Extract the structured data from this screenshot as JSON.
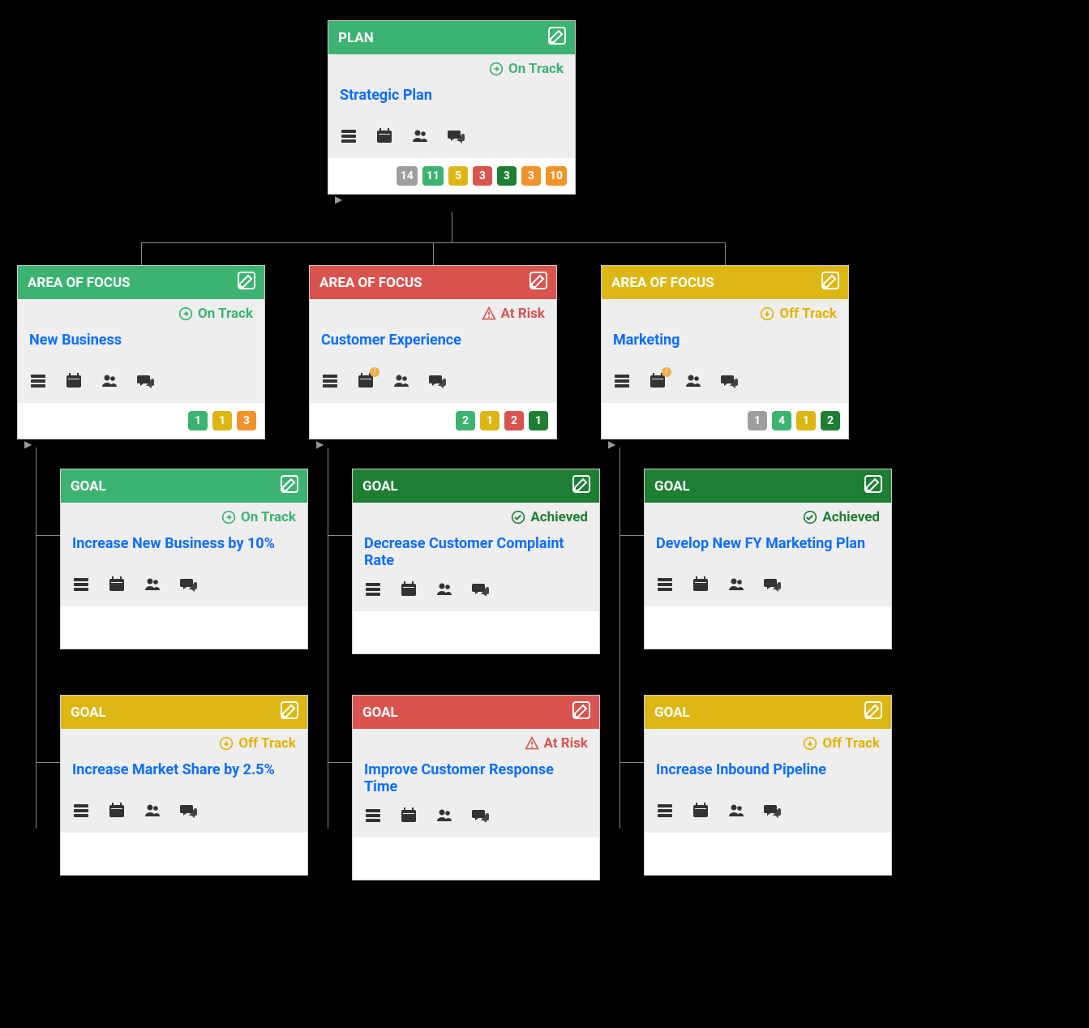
{
  "status_labels": {
    "on_track": "On Track",
    "off_track": "Off Track",
    "at_risk": "At Risk",
    "achieved": "Achieved"
  },
  "card_types": {
    "plan": "PLAN",
    "area": "AREA OF FOCUS",
    "goal": "GOAL"
  },
  "colors": {
    "green": "#3cb371",
    "dark_green": "#1e7e34",
    "yellow": "#dcb714",
    "red": "#d9534f",
    "orange": "#f0932b",
    "gray": "#9e9e9e"
  },
  "plan": {
    "title": "Strategic Plan",
    "status": "on_track",
    "header_color": "green",
    "badges": [
      {
        "n": 14,
        "c": "gray"
      },
      {
        "n": 11,
        "c": "green"
      },
      {
        "n": 5,
        "c": "yellow"
      },
      {
        "n": 3,
        "c": "red"
      },
      {
        "n": 3,
        "c": "dgreen"
      },
      {
        "n": 3,
        "c": "orange"
      },
      {
        "n": 10,
        "c": "orange"
      }
    ]
  },
  "areas": [
    {
      "title": "New Business",
      "status": "on_track",
      "header_color": "green",
      "calendar_alert": false,
      "badges": [
        {
          "n": 1,
          "c": "green"
        },
        {
          "n": 1,
          "c": "yellow"
        },
        {
          "n": 3,
          "c": "orange"
        }
      ],
      "goals": [
        {
          "title": "Increase New Business by 10%",
          "status": "on_track",
          "header_color": "green"
        },
        {
          "title": "Increase Market Share by 2.5%",
          "status": "off_track",
          "header_color": "yellow"
        }
      ]
    },
    {
      "title": "Customer Experience",
      "status": "at_risk",
      "header_color": "red",
      "calendar_alert": true,
      "badges": [
        {
          "n": 2,
          "c": "green"
        },
        {
          "n": 1,
          "c": "yellow"
        },
        {
          "n": 2,
          "c": "red"
        },
        {
          "n": 1,
          "c": "dgreen"
        }
      ],
      "goals": [
        {
          "title": "Decrease Customer Complaint Rate",
          "status": "achieved",
          "header_color": "dgreen"
        },
        {
          "title": "Improve Customer Response Time",
          "status": "at_risk",
          "header_color": "red"
        }
      ]
    },
    {
      "title": "Marketing",
      "status": "off_track",
      "header_color": "yellow",
      "calendar_alert": true,
      "badges": [
        {
          "n": 1,
          "c": "gray"
        },
        {
          "n": 4,
          "c": "green"
        },
        {
          "n": 1,
          "c": "yellow"
        },
        {
          "n": 2,
          "c": "dgreen"
        }
      ],
      "goals": [
        {
          "title": "Develop New FY Marketing Plan",
          "status": "achieved",
          "header_color": "dgreen"
        },
        {
          "title": "Increase Inbound Pipeline",
          "status": "off_track",
          "header_color": "yellow"
        }
      ]
    }
  ]
}
